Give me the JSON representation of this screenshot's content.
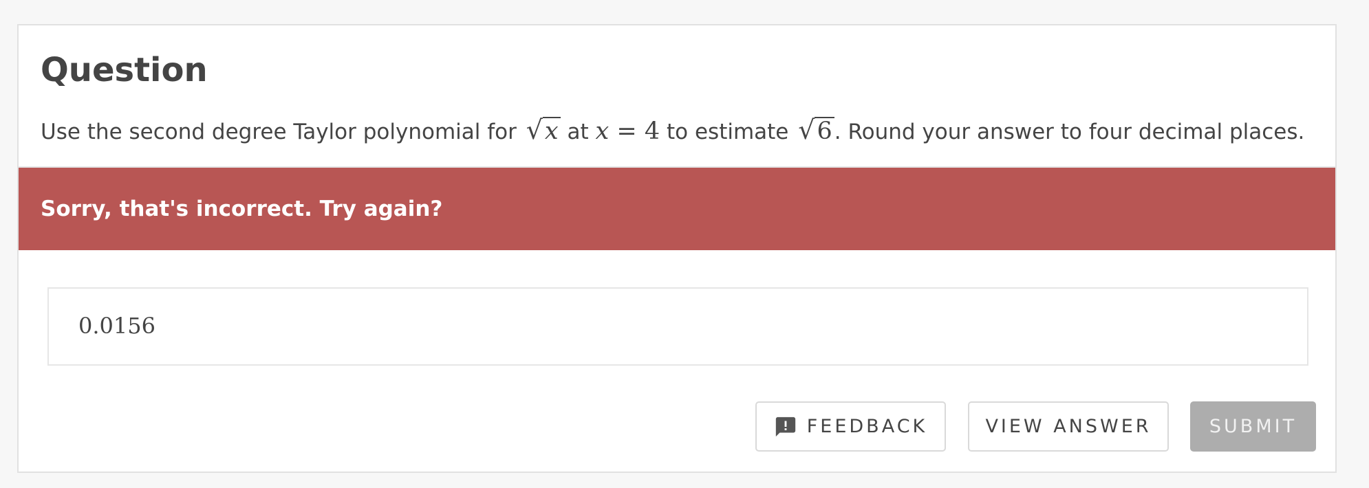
{
  "question": {
    "title": "Question",
    "text_part1": "Use the second degree Taylor polynomial for ",
    "sqrt_var": "x",
    "text_part2": " at ",
    "eq_var": "x",
    "eq_sign": " = ",
    "eq_value": "4",
    "text_part3": " to estimate ",
    "sqrt_num": "6",
    "text_part4": ". Round your answer to four decimal places."
  },
  "feedback": {
    "message": "Sorry, that's incorrect. Try again?",
    "color": "#b85654"
  },
  "answer": {
    "value": "0.0156"
  },
  "actions": {
    "feedback_label": "FEEDBACK",
    "feedback_icon": "feedback-icon",
    "view_answer_label": "VIEW ANSWER",
    "submit_label": "SUBMIT"
  }
}
